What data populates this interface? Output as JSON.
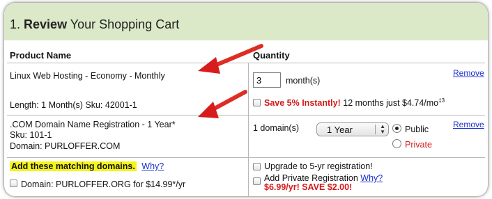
{
  "header": {
    "step": "1.",
    "title_bold": "Review",
    "title_rest": "Your Shopping Cart"
  },
  "columns": {
    "product": "Product Name",
    "quantity": "Quantity"
  },
  "rows": [
    {
      "product": "Linux Web Hosting - Economy - Monthly",
      "details": "Length: 1 Month(s) Sku: 42001-1",
      "qty_value": "3",
      "qty_unit": "month(s)",
      "remove": "Remove",
      "promo_red": "Save 5% Instantly!",
      "promo_text": "12 months just $4.74/mo",
      "promo_sup": "‡3"
    },
    {
      "product": ".COM Domain Name Registration - 1 Year*",
      "sku": "Sku: 101-1",
      "domain": "Domain: PURLOFFER.COM",
      "qty_text": "1 domain(s)",
      "select_value": "1 Year",
      "radio_public": "Public",
      "radio_private": "Private",
      "remove": "Remove"
    }
  ],
  "addons": {
    "title": "Add these matching domains.",
    "why": "Why?",
    "domain_offer": "Domain: PURLOFFER.ORG for $14.99*/yr",
    "upgrade": "Upgrade to 5-yr registration!",
    "private_reg": "Add Private Registration",
    "private_why": "Why?",
    "private_price": "$6.99/yr! SAVE $2.00!"
  },
  "colors": {
    "header_bg": "#dce9c8",
    "arrow_red": "#e02020",
    "link_blue": "#1a2fcc",
    "highlight": "#f5f51a"
  }
}
